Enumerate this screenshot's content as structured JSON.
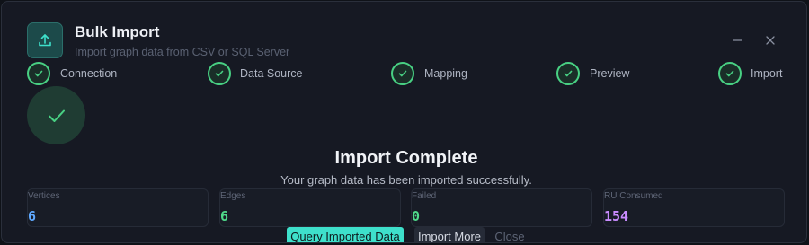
{
  "header": {
    "icon": "upload-icon",
    "title": "Bulk Import",
    "subtitle": "Import graph data from CSV or SQL Server",
    "minimize_icon": "minimize-icon",
    "close_icon": "close-icon"
  },
  "steps": [
    {
      "label": "Connection",
      "status": "complete"
    },
    {
      "label": "Data Source",
      "status": "complete"
    },
    {
      "label": "Mapping",
      "status": "complete"
    },
    {
      "label": "Preview",
      "status": "complete"
    },
    {
      "label": "Import",
      "status": "complete"
    }
  ],
  "result": {
    "icon": "check-icon",
    "title": "Import Complete",
    "message": "Your graph data has been imported successfully."
  },
  "stats": [
    {
      "label": "Vertices",
      "value": "6",
      "color": "#5ea8ff"
    },
    {
      "label": "Edges",
      "value": "6",
      "color": "#4fd98a"
    },
    {
      "label": "Failed",
      "value": "0",
      "color": "#4fd98a"
    },
    {
      "label": "RU Consumed",
      "value": "154",
      "color": "#c98cff"
    }
  ],
  "actions": {
    "query_label": "Query Imported Data",
    "import_more_label": "Import More",
    "close_label": "Close"
  },
  "colors": {
    "accent": "#3ee0cb",
    "success": "#48d083",
    "background": "#161923"
  }
}
